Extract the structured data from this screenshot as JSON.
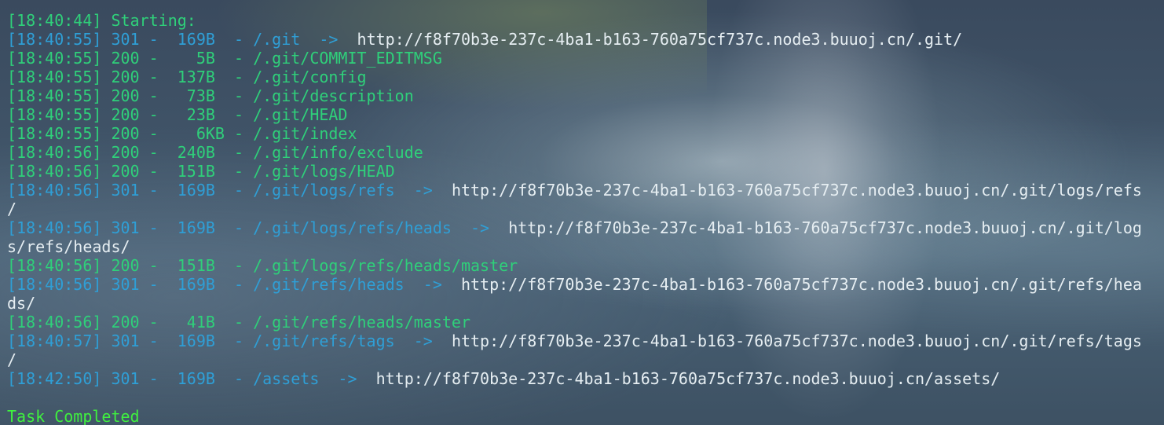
{
  "terminal": {
    "start": "[18:40:44] Starting:",
    "lines": [
      {
        "prefix": "[18:40:55] 301 -  169B  - /.git  ->  ",
        "url": "http://f8f70b3e-237c-4ba1-b163-760a75cf737c.node3.buuoj.cn/.git/"
      },
      {
        "prefix": "[18:40:55] 200 -    5B  - /.git/COMMIT_EDITMSG"
      },
      {
        "prefix": "[18:40:55] 200 -  137B  - /.git/config"
      },
      {
        "prefix": "[18:40:55] 200 -   73B  - /.git/description"
      },
      {
        "prefix": "[18:40:55] 200 -   23B  - /.git/HEAD"
      },
      {
        "prefix": "[18:40:55] 200 -    6KB - /.git/index"
      },
      {
        "prefix": "[18:40:56] 200 -  240B  - /.git/info/exclude"
      },
      {
        "prefix": "[18:40:56] 200 -  151B  - /.git/logs/HEAD"
      },
      {
        "prefix": "[18:40:56] 301 -  169B  - /.git/logs/refs  ->  ",
        "url": "http://f8f70b3e-237c-4ba1-b163-760a75cf737c.node3.buuoj.cn/.git/logs/refs",
        "wrap": "/"
      },
      {
        "prefix": "[18:40:56] 301 -  169B  - /.git/logs/refs/heads  ->  ",
        "url": "http://f8f70b3e-237c-4ba1-b163-760a75cf737c.node3.buuoj.cn/.git/log",
        "wrap": "s/refs/heads/"
      },
      {
        "prefix": "[18:40:56] 200 -  151B  - /.git/logs/refs/heads/master"
      },
      {
        "prefix": "[18:40:56] 301 -  169B  - /.git/refs/heads  ->  ",
        "url": "http://f8f70b3e-237c-4ba1-b163-760a75cf737c.node3.buuoj.cn/.git/refs/hea",
        "wrap": "ds/"
      },
      {
        "prefix": "[18:40:56] 200 -   41B  - /.git/refs/heads/master"
      },
      {
        "prefix": "[18:40:57] 301 -  169B  - /.git/refs/tags  ->  ",
        "url": "http://f8f70b3e-237c-4ba1-b163-760a75cf737c.node3.buuoj.cn/.git/refs/tags",
        "wrap": "/"
      },
      {
        "prefix": "[18:42:50] 301 -  169B  - /assets  ->  ",
        "url": "http://f8f70b3e-237c-4ba1-b163-760a75cf737c.node3.buuoj.cn/assets/"
      }
    ],
    "completed": "Task Completed"
  },
  "colors": {
    "ok": "#2fd07a",
    "redirect": "#2f9fd6",
    "url": "#e6eef2",
    "done": "#3ff03f"
  }
}
